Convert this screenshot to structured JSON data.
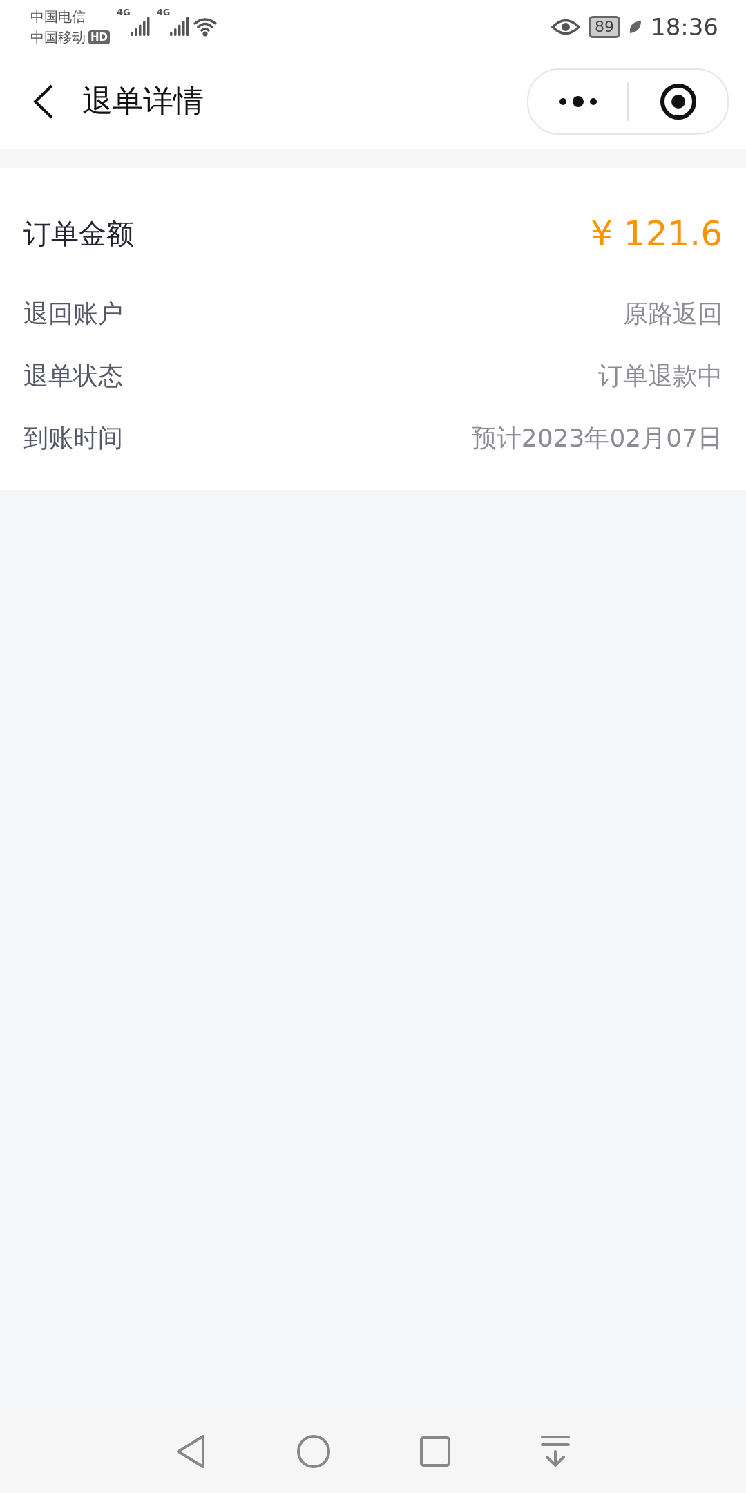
{
  "status_bar": {
    "carriers": [
      "中国电信",
      "中国移动"
    ],
    "hd": "HD",
    "network_labels": [
      "4G",
      "4G"
    ],
    "battery": "89",
    "time": "18:36"
  },
  "header": {
    "title": "退单详情"
  },
  "card": {
    "amount_label": "订单金额",
    "amount": "¥ 121.6",
    "rows": [
      {
        "label": "退回账户",
        "value": "原路返回"
      },
      {
        "label": "退单状态",
        "value": "订单退款中"
      },
      {
        "label": "到账时间",
        "value": "预计2023年02月07日"
      }
    ]
  }
}
